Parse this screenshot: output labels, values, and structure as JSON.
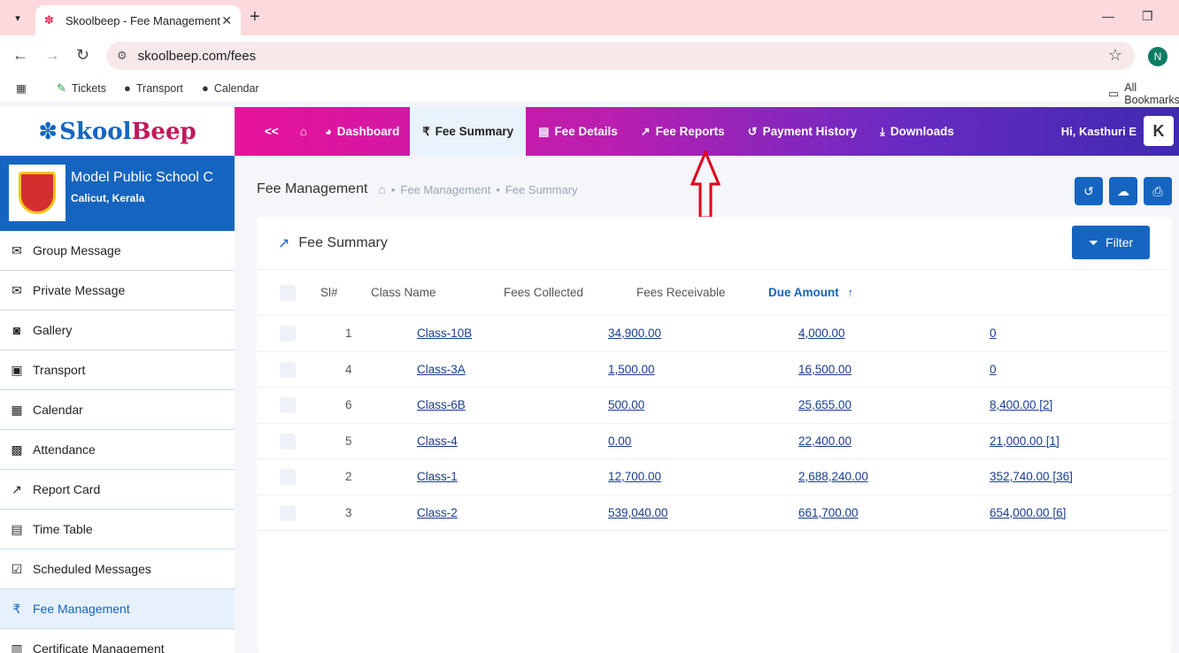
{
  "browser": {
    "tab_title": "Skoolbeep - Fee Management",
    "url": "skoolbeep.com/fees",
    "profile_initial": "N",
    "bookmarks": [
      "Tickets",
      "Transport",
      "Calendar"
    ],
    "all_bookmarks": "All Bookmarks"
  },
  "app": {
    "logo_part1": "Skool",
    "logo_part2": "Beep",
    "nav": {
      "back": "<<",
      "items": [
        "Dashboard",
        "Fee Summary",
        "Fee Details",
        "Fee Reports",
        "Payment History",
        "Downloads"
      ],
      "greeting": "Hi,  Kasthuri E",
      "avatar": "K"
    }
  },
  "school": {
    "name": "Model Public School C",
    "location": "Calicut, Kerala"
  },
  "sidebar": {
    "items": [
      "Group Message",
      "Private Message",
      "Gallery",
      "Transport",
      "Calendar",
      "Attendance",
      "Report Card",
      "Time Table",
      "Scheduled Messages",
      "Fee Management",
      "Certificate Management"
    ],
    "active": "Fee Management"
  },
  "page": {
    "title": "Fee Management",
    "breadcrumb": [
      "Fee Management",
      "Fee Summary"
    ]
  },
  "card": {
    "title": "Fee Summary",
    "filter_label": "Filter"
  },
  "table": {
    "headers": [
      "Sl#",
      "Class Name",
      "Fees Collected",
      "Fees Receivable",
      "Due Amount"
    ],
    "sort_indicator": "↑",
    "rows": [
      {
        "sl": "1",
        "class": "Class-10B",
        "collected": "34,900.00",
        "receivable": "4,000.00",
        "due": "0"
      },
      {
        "sl": "4",
        "class": "Class-3A",
        "collected": "1,500.00",
        "receivable": "16,500.00",
        "due": "0"
      },
      {
        "sl": "6",
        "class": "Class-6B",
        "collected": "500.00",
        "receivable": "25,655.00",
        "due": "8,400.00 [2]"
      },
      {
        "sl": "5",
        "class": "Class-4",
        "collected": "0.00",
        "receivable": "22,400.00",
        "due": "21,000.00 [1]"
      },
      {
        "sl": "2",
        "class": "Class-1",
        "collected": "12,700.00",
        "receivable": "2,688,240.00",
        "due": "352,740.00 [36]"
      },
      {
        "sl": "3",
        "class": "Class-2",
        "collected": "539,040.00",
        "receivable": "661,700.00",
        "due": "654,000.00 [6]"
      }
    ]
  },
  "colors": {
    "primary": "#1565c0",
    "nav_start": "#e8129a",
    "nav_end": "#3f2ab0",
    "annotation": "#e0001a"
  }
}
